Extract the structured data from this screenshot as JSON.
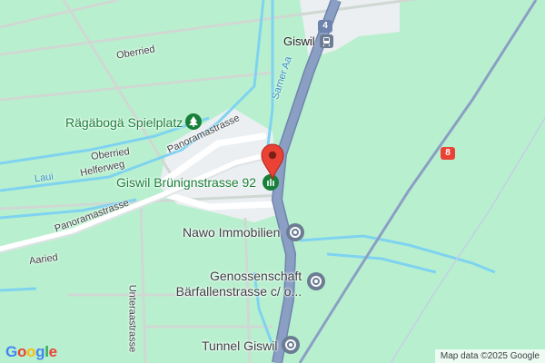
{
  "map": {
    "pin_label": "Giswil Brünignstrasse 92",
    "streets": {
      "oberried_top": "Oberried",
      "oberried_mid": "Oberried",
      "panoramastrasse_upper": "Panoramastrasse",
      "panoramastrasse_lower": "Panoramastrasse",
      "helferweg": "Helferweg",
      "aaried": "Aaried",
      "unteraastrasse": "Unteraastrasse"
    },
    "water": {
      "sarner_aa": "Sarner Aa",
      "laui": "Laui"
    },
    "places": {
      "giswil": "Giswil",
      "spielplatz": "Rägäbogä Spielplatz",
      "nawo": "Nawo Immobilien",
      "genossenschaft_line1": "Genossenschaft",
      "genossenschaft_line2": "Bärfallenstrasse c/ o...",
      "tunnel": "Tunnel Giswil"
    },
    "route_shields": {
      "top": "4",
      "right": "8"
    },
    "attribution": "Map data ©2025 Google",
    "logo_text": "Google",
    "colors": {
      "land": "#b8f0cf",
      "highway": "#8b9fc4",
      "water": "#7fd3f0",
      "pin": "#ea4335",
      "park_icon": "#188038",
      "poi_icon": "#6b7c93"
    },
    "icons": {
      "pin": "map-pin-icon",
      "park": "tree-icon",
      "transit": "train-station-icon",
      "poi": "generic-poi-icon"
    }
  }
}
